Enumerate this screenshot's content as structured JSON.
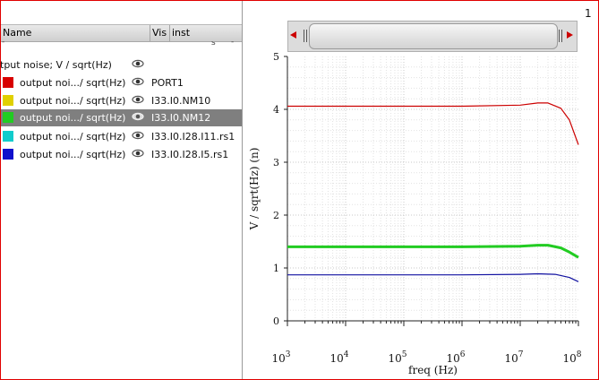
{
  "page_number": "1",
  "list": {
    "columns": {
      "name": "Name",
      "vis": "Vis",
      "inst": "inst"
    },
    "group_row": {
      "name": "tput noise; V / sqrt(Hz)"
    },
    "rows": [
      {
        "name": "output noi.../ sqrt(Hz)",
        "inst": "PORT1",
        "color": "#d80000",
        "selected": false
      },
      {
        "name": "output noi.../ sqrt(Hz)",
        "inst": "I33.I0.NM10",
        "color": "#e0d000",
        "selected": false
      },
      {
        "name": "output noi.../ sqrt(Hz)",
        "inst": "I33.I0.NM12",
        "color": "#22cc22",
        "selected": true
      },
      {
        "name": "output noi.../ sqrt(Hz)",
        "inst": "I33.I0.I28.I11.rs1",
        "color": "#11cccc",
        "selected": false
      },
      {
        "name": "output noi.../ sqrt(Hz)",
        "inst": "I33.I0.I28.I5.rs1",
        "color": "#1010cc",
        "selected": false
      }
    ]
  },
  "chart_data": {
    "type": "line",
    "xlabel": "freq (Hz)",
    "ylabel": "V / sqrt(Hz) (n)",
    "x_scale": "log",
    "xlim": [
      1000,
      100000000
    ],
    "ylim": [
      0,
      5
    ],
    "x_tick_exponents": [
      "3",
      "4",
      "5",
      "6",
      "7",
      "8"
    ],
    "x_tick_base": "10",
    "y_ticks": [
      "0",
      "1",
      "2",
      "3",
      "4",
      "5"
    ],
    "grid": true,
    "series": [
      {
        "color": "#cc0000",
        "points": [
          [
            1000,
            4.06
          ],
          [
            1000000,
            4.06
          ],
          [
            10000000,
            4.08
          ],
          [
            20000000,
            4.12
          ],
          [
            30000000,
            4.12
          ],
          [
            50000000,
            4.02
          ],
          [
            70000000,
            3.8
          ],
          [
            100000000,
            3.33
          ]
        ]
      },
      {
        "color": "#22cc22",
        "points": [
          [
            1000,
            1.4
          ],
          [
            1000000,
            1.4
          ],
          [
            10000000,
            1.41
          ],
          [
            20000000,
            1.43
          ],
          [
            30000000,
            1.43
          ],
          [
            50000000,
            1.38
          ],
          [
            70000000,
            1.3
          ],
          [
            100000000,
            1.2
          ]
        ]
      },
      {
        "color": "#1010a0",
        "points": [
          [
            1000,
            0.87
          ],
          [
            1000000,
            0.87
          ],
          [
            10000000,
            0.88
          ],
          [
            20000000,
            0.89
          ],
          [
            40000000,
            0.88
          ],
          [
            70000000,
            0.82
          ],
          [
            100000000,
            0.74
          ]
        ]
      }
    ]
  }
}
